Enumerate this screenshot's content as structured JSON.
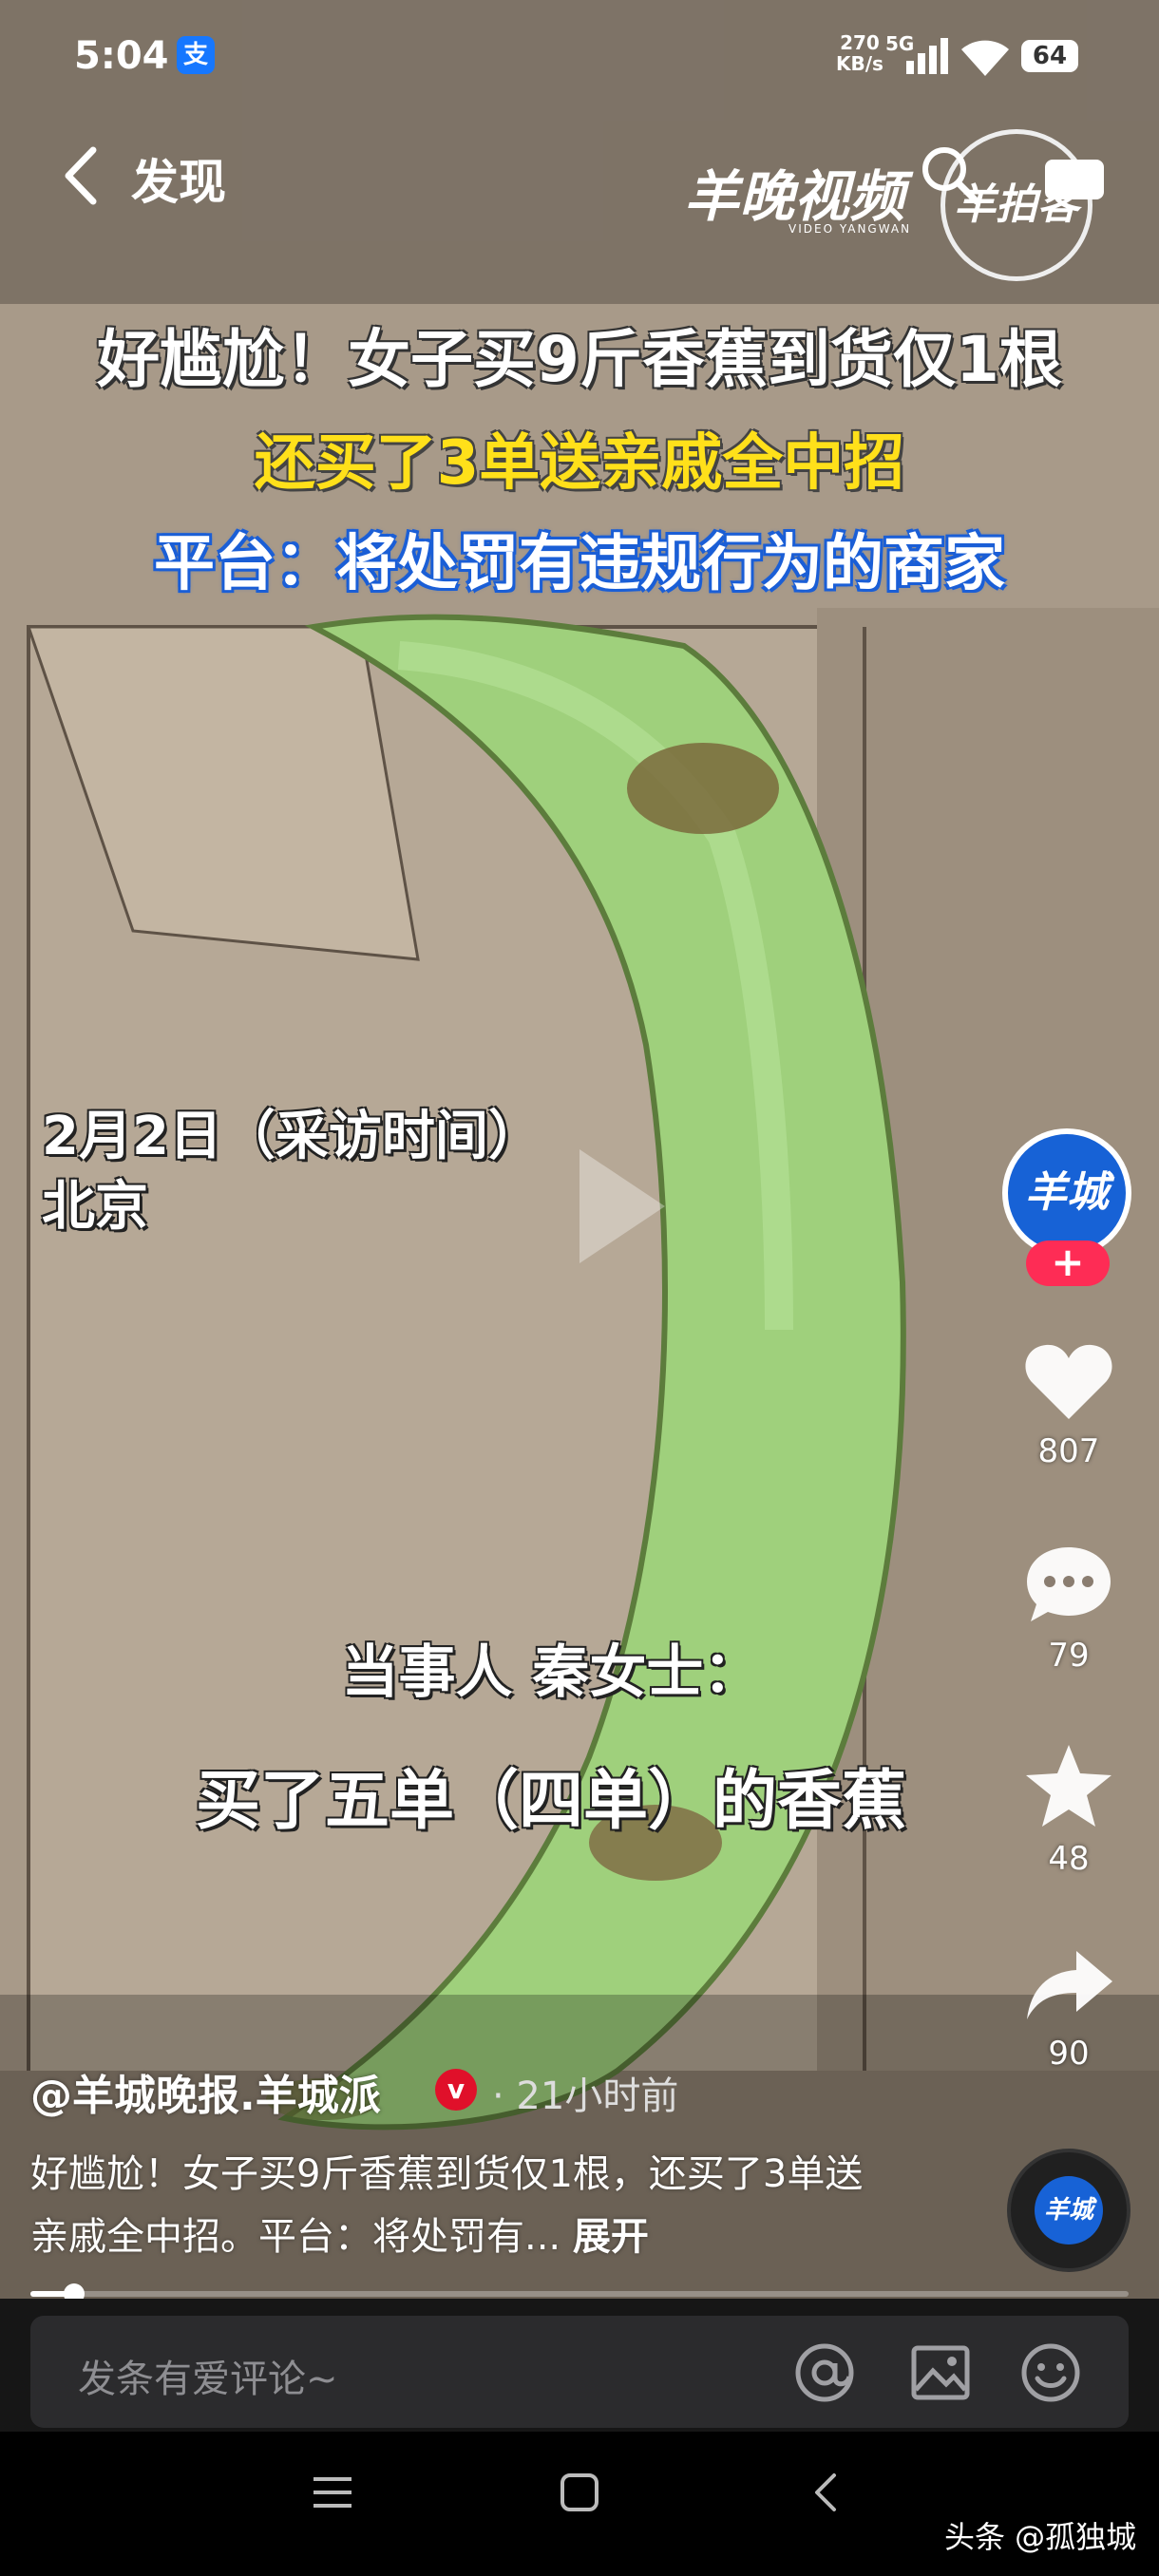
{
  "status_bar": {
    "time": "5:04",
    "alipay_glyph": "支",
    "net_speed": "270",
    "net_unit": "KB/s",
    "network": "5G",
    "battery": "64"
  },
  "nav": {
    "title": "发现",
    "logo_text": "羊晚视频",
    "logo_sub": "VIDEO YANGWAN",
    "seal_text": "羊拍客"
  },
  "video": {
    "headline_1": "好尴尬！女子买9斤香蕉到货仅1根",
    "headline_2": "还买了3单送亲戚全中招",
    "headline_3": "平台：将处罚有违规行为的商家",
    "date_line": "2月2日（采访时间）",
    "location_line": "北京",
    "caption_1": "当事人 秦女士：",
    "caption_2": "买了五单（四单）的香蕉"
  },
  "rail": {
    "avatar_text": "羊城",
    "follow_label": "+",
    "likes": "807",
    "comments": "79",
    "favorites": "48",
    "shares": "90",
    "disc_text": "羊城"
  },
  "post": {
    "author": "@羊城晚报.羊城派",
    "verified_glyph": "v",
    "time_ago": "· 21小时前",
    "description": "好尴尬！女子买9斤香蕉到货仅1根，还买了3单送亲戚全中招。平台：将处罚有...",
    "expand_label": "展开",
    "progress": 0.04
  },
  "comment_bar": {
    "placeholder": "发条有爱评论~"
  },
  "watermark": "头条 @孤独城",
  "icons": [
    "back-icon",
    "search-icon",
    "more-icon",
    "heart-icon",
    "comment-icon",
    "star-icon",
    "share-icon",
    "at-icon",
    "image-icon",
    "emoji-icon",
    "menu-icon",
    "home-icon",
    "nav-back-icon"
  ],
  "colors": {
    "headline_yellow": "#ffe01a",
    "follow_red": "#fe2c55",
    "banana_green": "#9ccf7a"
  }
}
